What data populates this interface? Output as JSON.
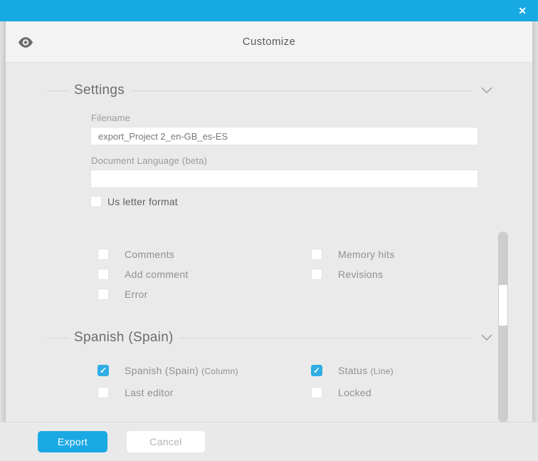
{
  "window": {
    "close_icon": "✕"
  },
  "icons": {
    "check": "✓"
  },
  "header": {
    "title": "Customize"
  },
  "settings": {
    "title": "Settings",
    "filename": {
      "label": "Filename",
      "value": "export_Project 2_en-GB_es-ES"
    },
    "document_language": {
      "label": "Document Language (beta)",
      "value": ""
    },
    "us_letter": {
      "label": "Us letter format",
      "checked": false
    },
    "options": [
      {
        "label": "Comments",
        "checked": false
      },
      {
        "label": "Memory hits",
        "checked": false
      },
      {
        "label": "Add comment",
        "checked": false
      },
      {
        "label": "Revisions",
        "checked": false
      },
      {
        "label": "Error",
        "checked": false
      }
    ]
  },
  "language": {
    "title": "Spanish (Spain)",
    "options": [
      {
        "label": "Spanish (Spain)",
        "suffix": "(Column)",
        "checked": true
      },
      {
        "label": "Status",
        "suffix": "(Line)",
        "checked": true
      },
      {
        "label": "Last editor",
        "suffix": "",
        "checked": false
      },
      {
        "label": "Locked",
        "suffix": "",
        "checked": false
      }
    ]
  },
  "footer": {
    "export_label": "Export",
    "cancel_label": "Cancel"
  },
  "colors": {
    "accent": "#17a9e2",
    "header_bg": "#f3f3f3",
    "body_bg": "#eaeaea"
  }
}
